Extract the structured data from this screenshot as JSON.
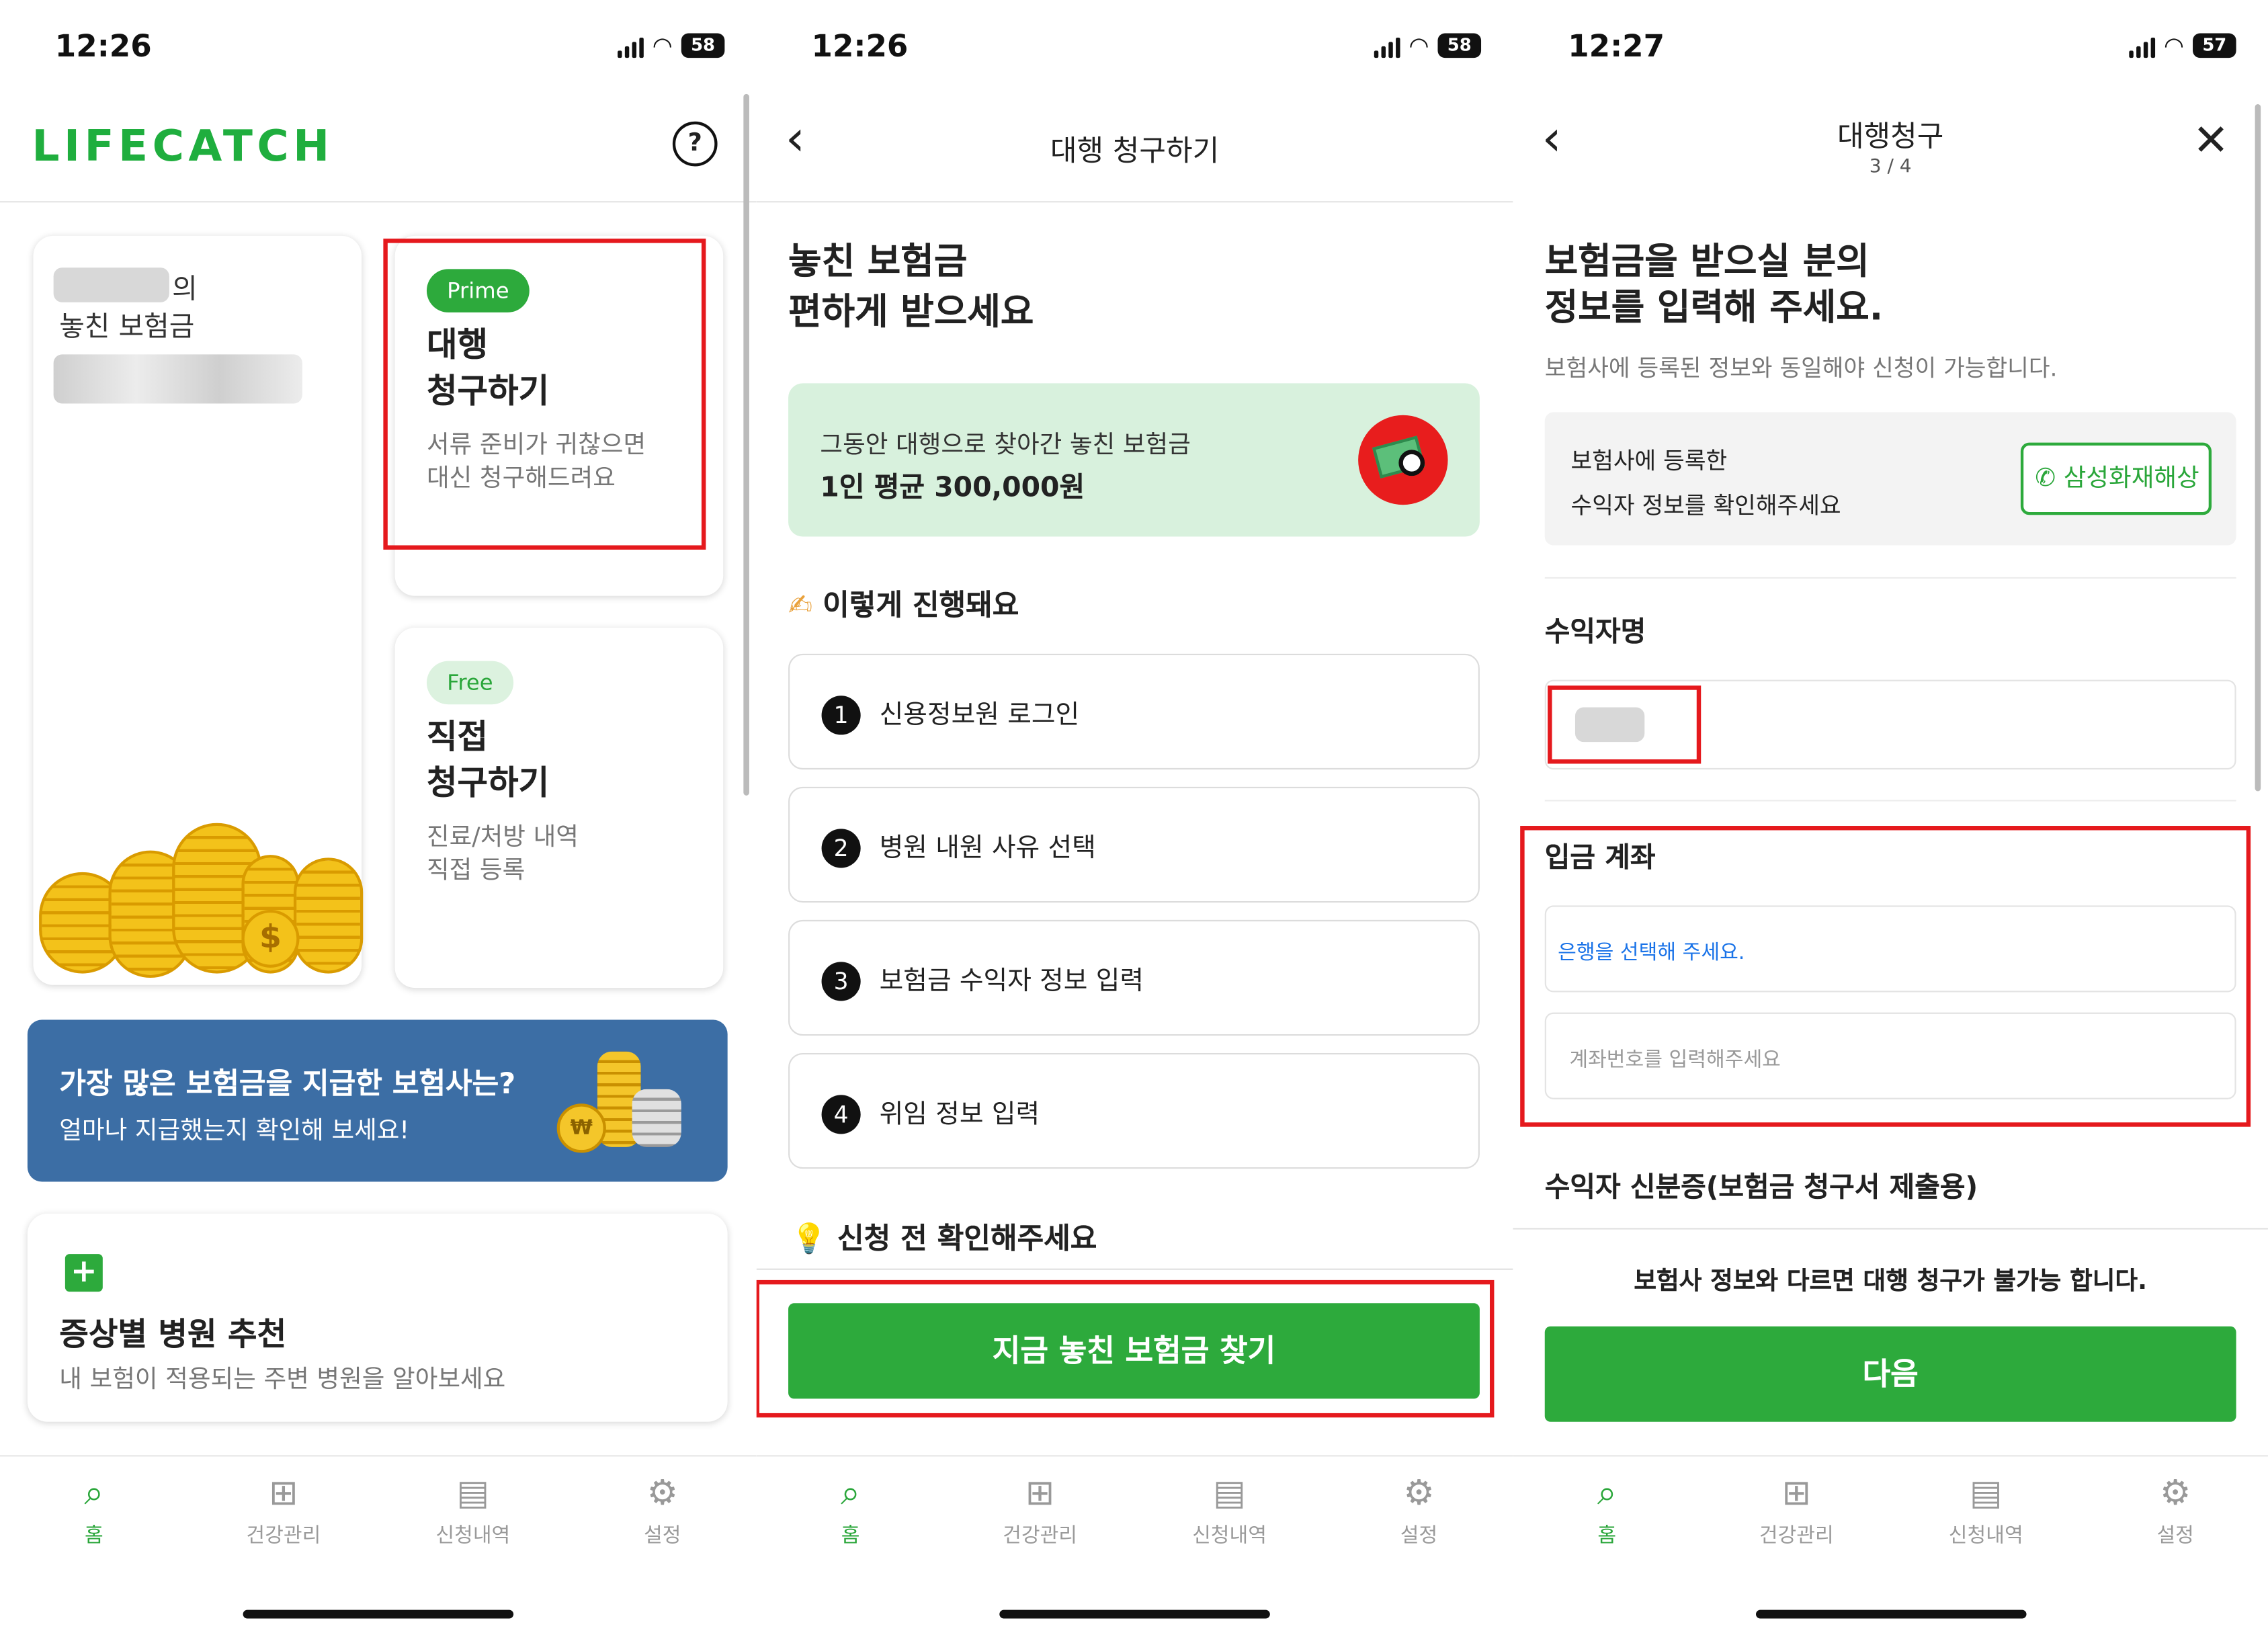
{
  "screen1": {
    "status_time": "12:26",
    "battery": "58",
    "logo": "LIFECATCH",
    "help_icon": "?",
    "missed_card": {
      "suffix": "의",
      "title": "놓친 보험금"
    },
    "prime_card": {
      "badge": "Prime",
      "title": "대행\n청구하기",
      "desc": "서류 준비가 귀찮으면\n대신 청구해드려요"
    },
    "free_card": {
      "badge": "Free",
      "title": "직접\n청구하기",
      "desc": "진료/처방 내역\n직접 등록"
    },
    "banner": {
      "title": "가장 많은 보험금을 지급한 보험사는?",
      "subtitle": "얼마나 지급했는지 확인해 보세요!",
      "coin_symbol": "₩"
    },
    "hospital_card": {
      "title": "증상별 병원 추천",
      "desc": "내 보험이 적용되는 주변 병원을 알아보세요"
    }
  },
  "screen2": {
    "status_time": "12:26",
    "battery": "58",
    "header_title": "대행 청구하기",
    "headline": "놓친 보험금\n편하게 받으세요",
    "info": {
      "line1": "그동안 대행으로 찾아간 놓친 보험금",
      "line2": "1인 평균 300,000원"
    },
    "process_title": "이렇게 진행돼요",
    "steps": [
      {
        "num": "1",
        "label": "신용정보원 로그인"
      },
      {
        "num": "2",
        "label": "병원 내원 사유 선택"
      },
      {
        "num": "3",
        "label": "보험금 수익자 정보 입력"
      },
      {
        "num": "4",
        "label": "위임 정보 입력"
      }
    ],
    "check_title": "신청 전 확인해주세요",
    "cta": "지금 놓친 보험금 찾기"
  },
  "screen3": {
    "status_time": "12:27",
    "battery": "57",
    "header_title": "대행청구",
    "step_indicator": "3 / 4",
    "headline": "보험금을 받으실 분의\n정보를 입력해 주세요.",
    "subtext": "보험사에 등록된 정보와 동일해야 신청이 가능합니다.",
    "insurer_box": {
      "line1": "보험사에 등록한",
      "line2": "수익자 정보를 확인해주세요",
      "button": "삼성화재해상"
    },
    "beneficiary_label": "수익자명",
    "account_label": "입금 계좌",
    "bank_placeholder": "은행을 선택해 주세요.",
    "account_placeholder": "계좌번호를 입력해주세요",
    "id_label": "수익자 신분증(보험금 청구서 제출용)",
    "warning": "보험사 정보와 다르면 대행 청구가 불가능 합니다.",
    "next_button": "다음"
  },
  "tabbar": [
    {
      "label": "홈",
      "icon": "home-search-icon"
    },
    {
      "label": "건강관리",
      "icon": "plus-square-icon"
    },
    {
      "label": "신청내역",
      "icon": "document-icon"
    },
    {
      "label": "설정",
      "icon": "gear-icon"
    }
  ],
  "colors": {
    "brand_green": "#2daa3c",
    "highlight_red": "#e5191d",
    "banner_blue": "#3c6ea5",
    "info_green": "#d8f1dd",
    "link_blue": "#1a73e8"
  }
}
